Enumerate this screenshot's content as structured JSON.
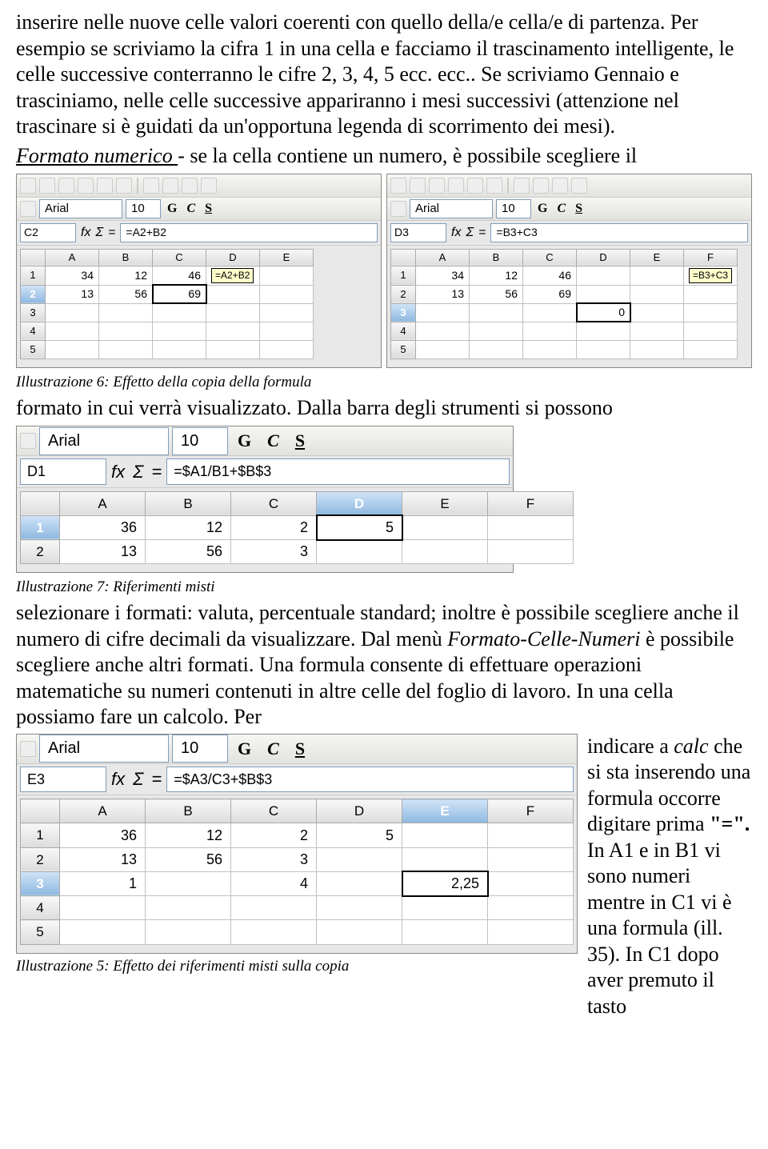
{
  "para1_a": "inserire nelle nuove celle valori coerenti con quello della/e cella/e di partenza. Per esempio se scriviamo la cifra 1 in una cella e facciamo il trascinamento intelligente, le celle successive conterranno le cifre 2, 3, 4, 5 ecc. ecc.. Se scriviamo Gennaio e trasciniamo, nelle celle successive appariranno i mesi successivi (attenzione nel trascinare si è guidati da un'opportuna legenda di scorrimento dei mesi).",
  "para1_b_label": "Formato numerico ",
  "para1_b_rest": "- se la cella contiene un numero, è possibile scegliere il",
  "caption6": "Illustrazione 6: Effetto della copia della formula",
  "para2": "formato in cui verrà visualizzato. Dalla barra degli strumenti si possono",
  "caption7": "Illustrazione 7: Riferimenti misti",
  "para3_a": "selezionare i formati: valuta, percentuale standard; inoltre è possibile scegliere anche il numero di cifre decimali da visualizzare. Dal menù ",
  "para3_menu": "Formato-Celle-Numeri",
  "para3_b": " è possibile scegliere anche altri formati. Una formula consente di effettuare operazioni matematiche su numeri contenuti in altre celle del foglio di lavoro. In una cella possiamo fare un calcolo. Per ",
  "para4_a": "indicare a ",
  "para4_calc": "calc",
  "para4_b": " che si sta inserendo una formula occorre digitare prima ",
  "para4_eq": "\"=\". ",
  "para4_c": "In A1 e in B1 vi sono numeri mentre in C1 vi è una formula (ill. 35). In C1 dopo aver premuto il tasto",
  "caption5": "Illustrazione 5: Effetto dei riferimenti misti sulla copia",
  "ssL": {
    "font": "Arial",
    "size": "10",
    "cellRef": "C2",
    "formula": "=A2+B2",
    "cols": [
      "A",
      "B",
      "C",
      "D",
      "E"
    ],
    "rows": [
      [
        "34",
        "12",
        "46",
        "=A2+B2",
        ""
      ],
      [
        "13",
        "56",
        "69",
        "",
        ""
      ],
      [
        "",
        "",
        "",
        "",
        ""
      ],
      [
        "",
        "",
        "",
        "",
        ""
      ],
      [
        "",
        "",
        "",
        "",
        ""
      ]
    ]
  },
  "ssR": {
    "font": "Arial",
    "size": "10",
    "cellRef": "D3",
    "formula": "=B3+C3",
    "cols": [
      "A",
      "B",
      "C",
      "D",
      "E",
      "F"
    ],
    "rows": [
      [
        "34",
        "12",
        "46",
        "",
        "",
        "=B3+C3"
      ],
      [
        "13",
        "56",
        "69",
        "",
        "",
        ""
      ],
      [
        "",
        "",
        "",
        "0",
        "",
        ""
      ],
      [
        "",
        "",
        "",
        "",
        "",
        ""
      ],
      [
        "",
        "",
        "",
        "",
        "",
        ""
      ]
    ]
  },
  "ss7": {
    "font": "Arial",
    "size": "10",
    "cellRef": "D1",
    "formula": "=$A1/B1+$B$3",
    "cols": [
      "A",
      "B",
      "C",
      "D",
      "E",
      "F"
    ],
    "rows": [
      [
        "36",
        "12",
        "2",
        "5",
        "",
        ""
      ],
      [
        "13",
        "56",
        "3",
        "",
        "",
        ""
      ]
    ]
  },
  "ss5": {
    "font": "Arial",
    "size": "10",
    "cellRef": "E3",
    "formula": "=$A3/C3+$B$3",
    "cols": [
      "A",
      "B",
      "C",
      "D",
      "E",
      "F"
    ],
    "rows": [
      [
        "36",
        "12",
        "2",
        "5",
        "",
        ""
      ],
      [
        "13",
        "56",
        "3",
        "",
        "",
        ""
      ],
      [
        "1",
        "",
        "4",
        "",
        "2,25",
        ""
      ],
      [
        "",
        "",
        "",
        "",
        "",
        ""
      ],
      [
        "",
        "",
        "",
        "",
        "",
        ""
      ]
    ]
  },
  "fmt": {
    "g": "G",
    "c": "C",
    "s": "S"
  },
  "fx": {
    "fx": "fx",
    "sigma": "Σ",
    "eq": "="
  }
}
